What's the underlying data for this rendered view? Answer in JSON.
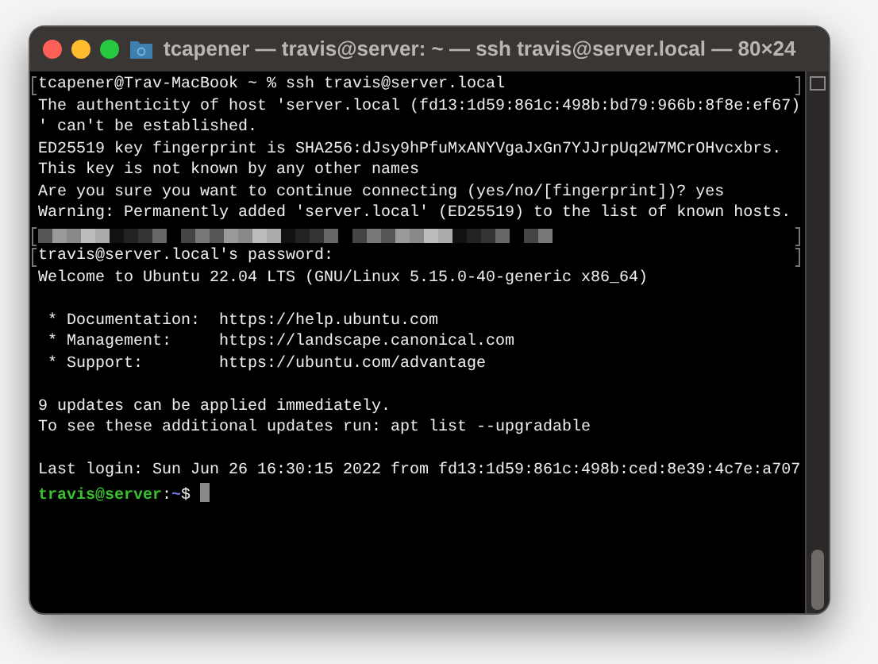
{
  "window": {
    "title": "tcapener — travis@server: ~ — ssh travis@server.local — 80×24"
  },
  "terminal": {
    "lines": [
      {
        "kind": "text",
        "text": "tcapener@Trav-MacBook ~ % ssh travis@server.local",
        "marked": true
      },
      {
        "kind": "text",
        "text": "The authenticity of host 'server.local (fd13:1d59:861c:498b:bd79:966b:8f8e:ef67)",
        "marked": false
      },
      {
        "kind": "text",
        "text": "' can't be established.",
        "marked": false
      },
      {
        "kind": "text",
        "text": "ED25519 key fingerprint is SHA256:dJsy9hPfuMxANYVgaJxGn7YJJrpUq2W7MCrOHvcxbrs.",
        "marked": false
      },
      {
        "kind": "text",
        "text": "This key is not known by any other names",
        "marked": false
      },
      {
        "kind": "text",
        "text": "Are you sure you want to continue connecting (yes/no/[fingerprint])? yes",
        "marked": false
      },
      {
        "kind": "text",
        "text": "Warning: Permanently added 'server.local' (ED25519) to the list of known hosts.",
        "marked": false
      },
      {
        "kind": "redacted",
        "marked": true
      },
      {
        "kind": "text",
        "text": "travis@server.local's password:",
        "marked": true
      },
      {
        "kind": "text",
        "text": "Welcome to Ubuntu 22.04 LTS (GNU/Linux 5.15.0-40-generic x86_64)",
        "marked": false
      },
      {
        "kind": "blank",
        "marked": false
      },
      {
        "kind": "text",
        "text": " * Documentation:  https://help.ubuntu.com",
        "marked": false
      },
      {
        "kind": "text",
        "text": " * Management:     https://landscape.canonical.com",
        "marked": false
      },
      {
        "kind": "text",
        "text": " * Support:        https://ubuntu.com/advantage",
        "marked": false
      },
      {
        "kind": "blank",
        "marked": false
      },
      {
        "kind": "text",
        "text": "9 updates can be applied immediately.",
        "marked": false
      },
      {
        "kind": "text",
        "text": "To see these additional updates run: apt list --upgradable",
        "marked": false
      },
      {
        "kind": "blank",
        "marked": false
      },
      {
        "kind": "text",
        "text": "Last login: Sun Jun 26 16:30:15 2022 from fd13:1d59:861c:498b:ced:8e39:4c7e:a707",
        "marked": false
      },
      {
        "kind": "prompt",
        "user": "travis@server",
        "separator": ":",
        "path": "~",
        "symbol": "$",
        "marked": false
      }
    ]
  }
}
